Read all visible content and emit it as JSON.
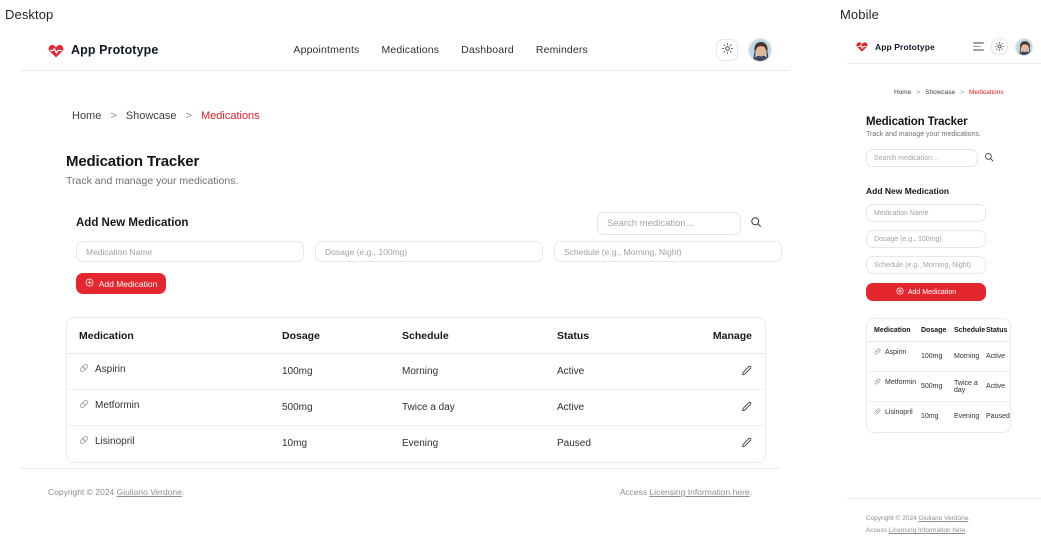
{
  "captions": {
    "desktop": "Desktop",
    "mobile": "Mobile"
  },
  "brand": {
    "name": "App Prototype",
    "icon": "heart-pulse-icon",
    "color": "#e4262f"
  },
  "nav": {
    "links": [
      {
        "label": "Appointments"
      },
      {
        "label": "Medications"
      },
      {
        "label": "Dashboard"
      },
      {
        "label": "Reminders"
      }
    ],
    "theme_toggle_icon": "sun-icon",
    "menu_icon": "hamburger-icon",
    "avatar_label": "user-avatar"
  },
  "breadcrumb": {
    "items": [
      {
        "label": "Home",
        "current": false
      },
      {
        "label": "Showcase",
        "current": false
      },
      {
        "label": "Medications",
        "current": true
      }
    ],
    "separator": ">",
    "current_color": "#e4202a"
  },
  "page": {
    "title": "Medication Tracker",
    "subtitle": "Track and manage your medications."
  },
  "search": {
    "placeholder": "Search medication...",
    "icon": "search-icon"
  },
  "add_form": {
    "title": "Add New Medication",
    "fields": [
      {
        "placeholder": "Medication Name"
      },
      {
        "placeholder": "Dosage (e.g., 100mg)"
      },
      {
        "placeholder": "Schedule (e.g., Morning, Night)"
      }
    ],
    "button_label": "Add Medication",
    "button_icon": "plus-circle-icon",
    "button_color": "#e4262f"
  },
  "table": {
    "columns": [
      "Medication",
      "Dosage",
      "Schedule",
      "Status",
      "Manage"
    ],
    "row_icon": "pill-icon",
    "edit_icon": "pencil-icon",
    "rows": [
      {
        "medication": "Aspirin",
        "dosage": "100mg",
        "schedule": "Morning",
        "status": "Active",
        "status_kind": "active"
      },
      {
        "medication": "Metformin",
        "dosage": "500mg",
        "schedule": "Twice a day",
        "status": "Active",
        "status_kind": "active"
      },
      {
        "medication": "Lisinopril",
        "dosage": "10mg",
        "schedule": "Evening",
        "status": "Paused",
        "status_kind": "paused"
      }
    ],
    "status_colors": {
      "active": "#24b05c",
      "paused": "#e0a315"
    }
  },
  "footer": {
    "copyright_prefix": "Copyright © 2024 ",
    "author": "Giuliano Verdone",
    "copyright_suffix": ".",
    "access_prefix": "Access ",
    "license_link": "Licensing Information here",
    "access_suffix": "."
  }
}
